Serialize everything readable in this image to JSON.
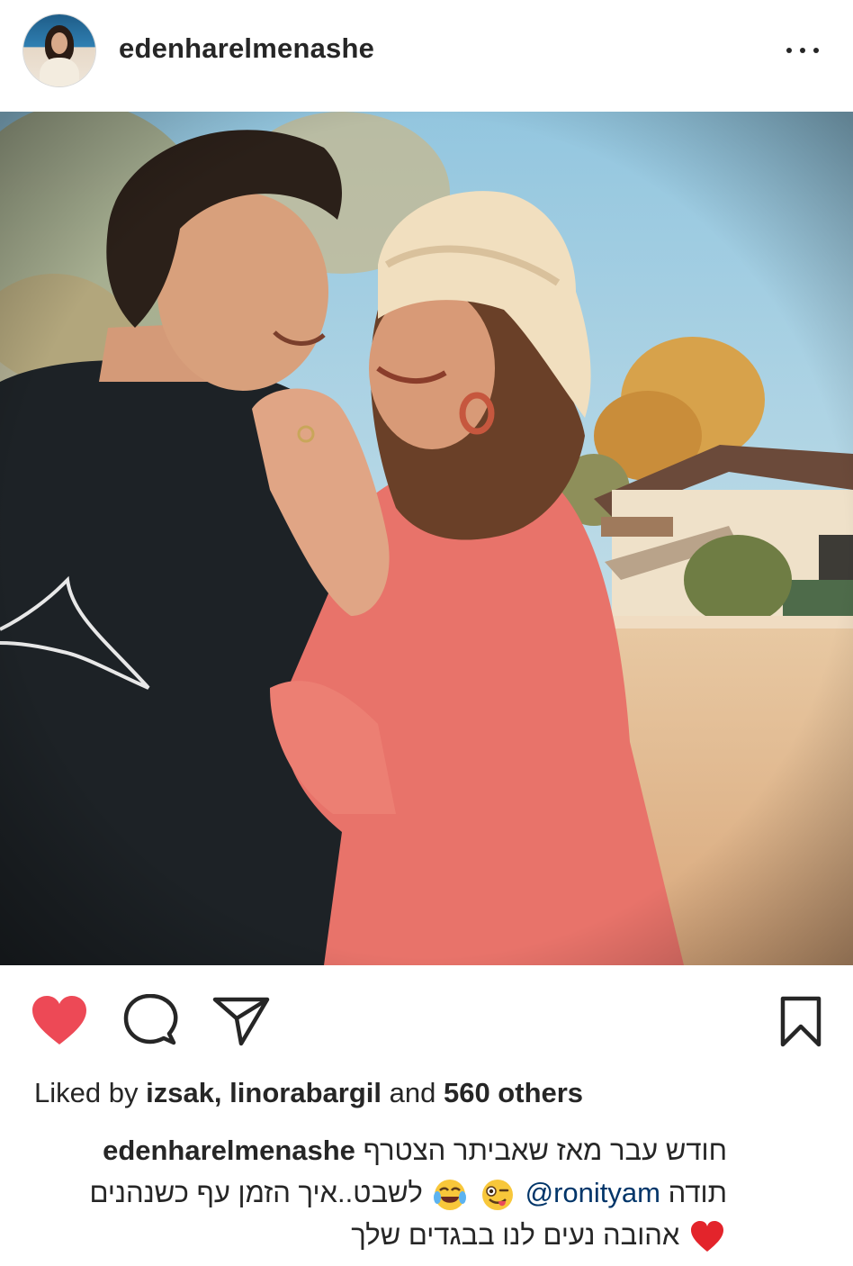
{
  "post": {
    "username": "edenharelmenashe",
    "liked_by": {
      "prefix": "Liked by",
      "user1": "izsak,",
      "user2": "linorabargil",
      "connector": "and",
      "others": "560 others"
    },
    "caption": {
      "username": "edenharelmenashe",
      "line1": "חודש עבר מאז שאביתר הצטרף",
      "thanks": "תודה",
      "mention": "@ronityam",
      "line2_rest": "לשבט..איך הזמן עף כשנהנים",
      "line3": "אהובה נעים לנו בבגדים שלך"
    }
  },
  "icons": {
    "more": "more-dots-icon",
    "like": "heart-filled-icon",
    "comment": "comment-bubble-icon",
    "share": "paper-plane-icon",
    "save": "bookmark-icon",
    "emoji1": "winking-face-tongue-emoji",
    "emoji2": "tears-of-joy-emoji",
    "emoji3": "red-heart-emoji"
  },
  "colors": {
    "like_red": "#ed4956",
    "text": "#262626",
    "mention_blue": "#003569"
  }
}
